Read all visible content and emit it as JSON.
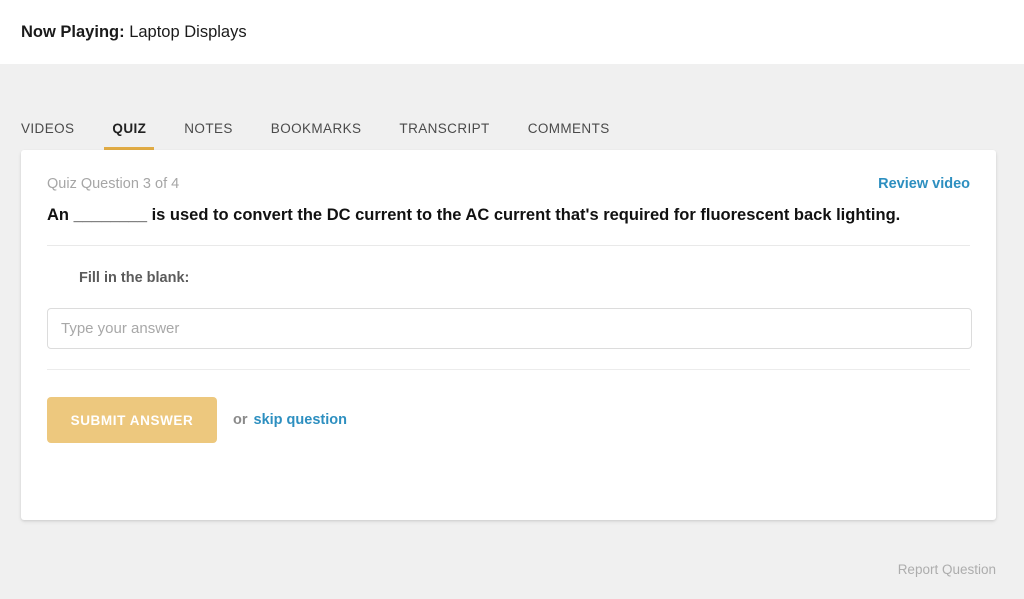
{
  "header": {
    "now_playing_label": "Now Playing:",
    "now_playing_title": "Laptop Displays"
  },
  "tabs": [
    {
      "label": "VIDEOS",
      "active": false
    },
    {
      "label": "QUIZ",
      "active": true
    },
    {
      "label": "NOTES",
      "active": false
    },
    {
      "label": "BOOKMARKS",
      "active": false
    },
    {
      "label": "TRANSCRIPT",
      "active": false
    },
    {
      "label": "COMMENTS",
      "active": false
    }
  ],
  "quiz": {
    "counter": "Quiz Question 3 of 4",
    "review_video_label": "Review video",
    "question": "An ________ is used to convert the DC current to the AC current that's required for fluorescent back lighting.",
    "fill_label": "Fill in the blank:",
    "answer_value": "",
    "answer_placeholder": "Type your answer",
    "submit_label": "SUBMIT ANSWER",
    "or_label": "or",
    "skip_label": "skip question"
  },
  "footer": {
    "report_label": "Report Question"
  },
  "colors": {
    "accent_gold": "#e0ab44",
    "button_gold": "#edc87e",
    "link_blue": "#2d8fc0",
    "page_bg": "#f0f0f0",
    "card_bg": "#ffffff",
    "muted_text": "#a6a6a6"
  }
}
